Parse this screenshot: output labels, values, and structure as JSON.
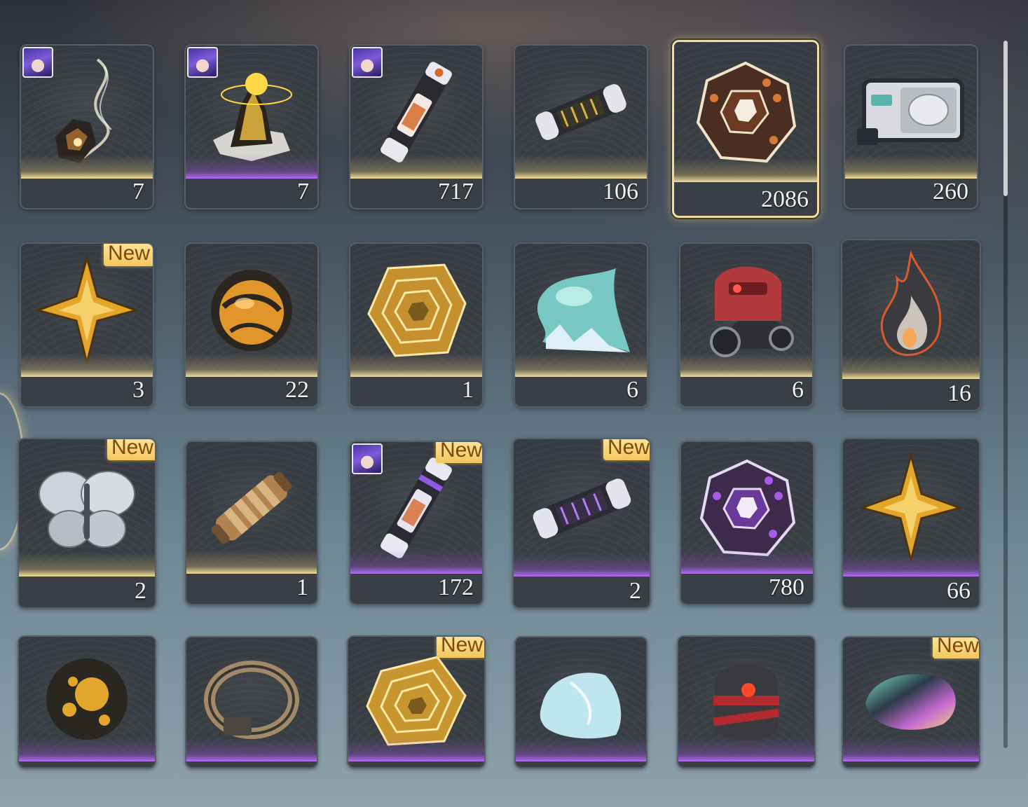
{
  "inventory": {
    "rows": [
      [
        {
          "name": "wisp-fragment",
          "qty": "7",
          "rarity": "gold",
          "new": false,
          "avatar": true
        },
        {
          "name": "golden-relic",
          "qty": "7",
          "rarity": "purple",
          "new": false,
          "avatar": true
        },
        {
          "name": "energy-capsule",
          "qty": "717",
          "rarity": "gold",
          "new": false,
          "avatar": true
        },
        {
          "name": "tech-cylinder",
          "qty": "106",
          "rarity": "gold",
          "new": false,
          "avatar": false
        },
        {
          "name": "hex-die-brown",
          "qty": "2086",
          "rarity": "gold",
          "new": false,
          "avatar": false,
          "selected": true
        },
        {
          "name": "data-drive",
          "qty": "260",
          "rarity": "gold",
          "new": false,
          "avatar": false
        }
      ],
      [
        {
          "name": "gold-star-shard",
          "qty": "3",
          "rarity": "gold",
          "new": true,
          "avatar": false
        },
        {
          "name": "amber-orb",
          "qty": "22",
          "rarity": "gold",
          "new": false,
          "avatar": false
        },
        {
          "name": "golden-maze-core",
          "qty": "1",
          "rarity": "gold",
          "new": false,
          "avatar": false
        },
        {
          "name": "ice-crystal",
          "qty": "6",
          "rarity": "gold",
          "new": false,
          "avatar": false
        },
        {
          "name": "red-mech-helmet",
          "qty": "6",
          "rarity": "gold",
          "new": false,
          "avatar": false
        },
        {
          "name": "flame-drop",
          "qty": "16",
          "rarity": "gold",
          "new": false,
          "avatar": false
        }
      ],
      [
        {
          "name": "silver-butterfly",
          "qty": "2",
          "rarity": "gold",
          "new": true,
          "avatar": false
        },
        {
          "name": "bronze-cylinder",
          "qty": "1",
          "rarity": "gold",
          "new": false,
          "avatar": false
        },
        {
          "name": "violet-capsule",
          "qty": "172",
          "rarity": "purple",
          "new": true,
          "avatar": true
        },
        {
          "name": "violet-tech-cylinder",
          "qty": "2",
          "rarity": "purple",
          "new": true,
          "avatar": false
        },
        {
          "name": "hex-die-purple",
          "qty": "780",
          "rarity": "purple",
          "new": false,
          "avatar": false
        },
        {
          "name": "gold-star-shard-2",
          "qty": "66",
          "rarity": "purple",
          "new": false,
          "avatar": false
        }
      ],
      [
        {
          "name": "cracked-amber-orb",
          "qty": "",
          "rarity": "purple",
          "new": false,
          "avatar": false
        },
        {
          "name": "bronze-ring",
          "qty": "",
          "rarity": "purple",
          "new": false,
          "avatar": false
        },
        {
          "name": "golden-maze-shard",
          "qty": "",
          "rarity": "purple",
          "new": true,
          "avatar": false
        },
        {
          "name": "ice-fragment",
          "qty": "",
          "rarity": "purple",
          "new": false,
          "avatar": false
        },
        {
          "name": "bandaged-helmet",
          "qty": "",
          "rarity": "purple",
          "new": false,
          "avatar": false
        },
        {
          "name": "iridescent-stone",
          "qty": "",
          "rarity": "purple",
          "new": true,
          "avatar": false
        }
      ]
    ],
    "new_label": "New"
  },
  "colors": {
    "gold_rarity": "#f2dc9a",
    "purple_rarity": "#b36cf0",
    "badge_bg": "#f3c75c",
    "selected_border": "#efdca0"
  }
}
